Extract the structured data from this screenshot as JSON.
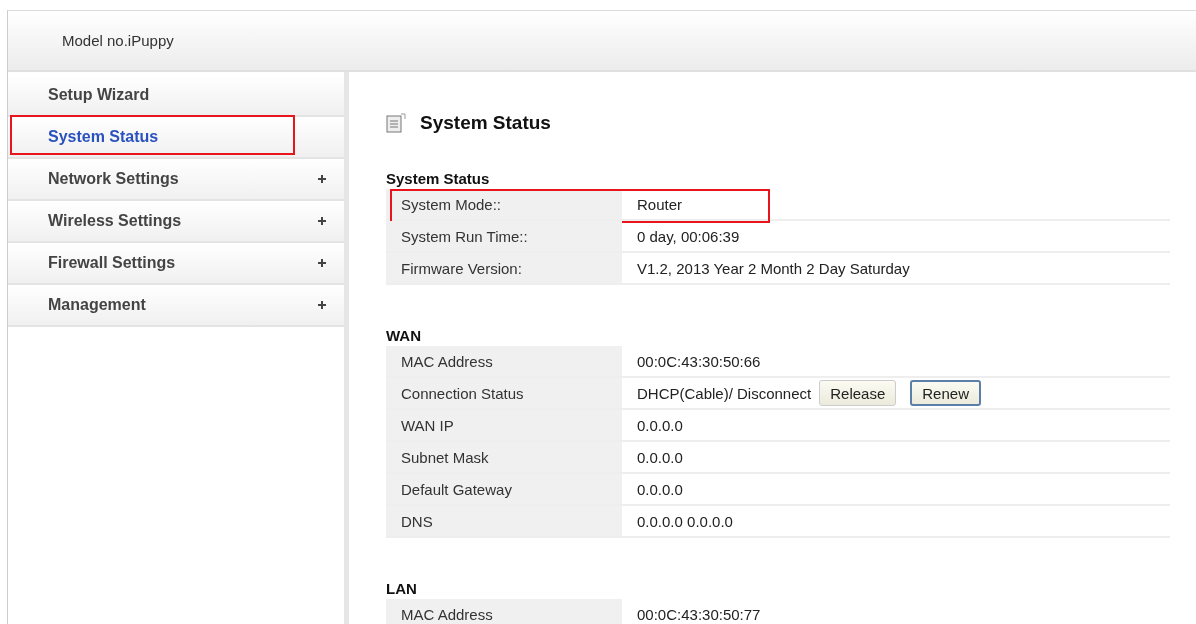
{
  "header": {
    "model": "Model no.iPuppy"
  },
  "sidebar": {
    "items": [
      {
        "label": "Setup Wizard",
        "selected": false,
        "expandable": false,
        "highlighted": false
      },
      {
        "label": "System Status",
        "selected": true,
        "expandable": false,
        "highlighted": true
      },
      {
        "label": "Network Settings",
        "selected": false,
        "expandable": true,
        "highlighted": false
      },
      {
        "label": "Wireless Settings",
        "selected": false,
        "expandable": true,
        "highlighted": false
      },
      {
        "label": "Firewall Settings",
        "selected": false,
        "expandable": true,
        "highlighted": false
      },
      {
        "label": "Management",
        "selected": false,
        "expandable": true,
        "highlighted": false
      }
    ]
  },
  "page_title": "System Status",
  "sections": [
    {
      "title": "System Status",
      "rows": [
        {
          "label": "System Mode::",
          "value": "Router",
          "highlighted": true
        },
        {
          "label": "System Run Time::",
          "value": "0 day, 00:06:39",
          "highlighted": false
        },
        {
          "label": "Firmware Version:",
          "value": "V1.2,  2013 Year 2 Month 2 Day Saturday",
          "highlighted": false
        }
      ]
    },
    {
      "title": "WAN",
      "rows": [
        {
          "label": "MAC Address",
          "value": "00:0C:43:30:50:66",
          "highlighted": false
        },
        {
          "label": "Connection Status",
          "value": "DHCP(Cable)/ Disconnect",
          "highlighted": false,
          "buttons": [
            {
              "label": "Release",
              "focused": false
            },
            {
              "label": "Renew",
              "focused": true
            }
          ]
        },
        {
          "label": "WAN IP",
          "value": "0.0.0.0",
          "highlighted": false
        },
        {
          "label": "Subnet Mask",
          "value": "0.0.0.0",
          "highlighted": false
        },
        {
          "label": "Default Gateway",
          "value": "0.0.0.0",
          "highlighted": false
        },
        {
          "label": "DNS",
          "value": "0.0.0.0 0.0.0.0",
          "highlighted": false
        }
      ]
    },
    {
      "title": "LAN",
      "rows": [
        {
          "label": "MAC Address",
          "value": "00:0C:43:30:50:77",
          "highlighted": false
        }
      ]
    }
  ]
}
